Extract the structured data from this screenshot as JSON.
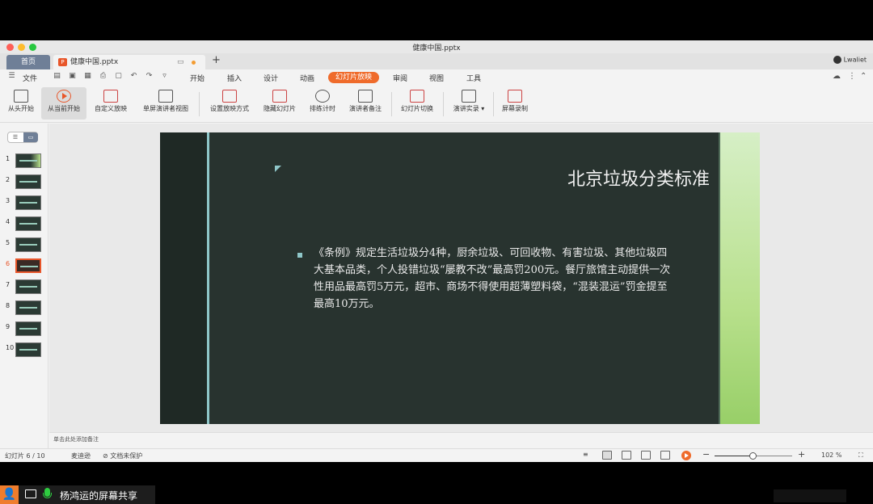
{
  "window": {
    "title": "健康中国.pptx",
    "tab_home": "首页",
    "tab_doc": "健康中国.pptx",
    "user": "Lwaliet"
  },
  "menu": {
    "file": "文件",
    "items": [
      "开始",
      "插入",
      "设计",
      "动画",
      "幻灯片放映",
      "审阅",
      "视图",
      "工具"
    ],
    "active": "幻灯片放映"
  },
  "ribbon": {
    "from_start": "从头开始",
    "from_current": "从当前开始",
    "custom_show": "自定义放映",
    "presenter_view": "单屏演讲者视图",
    "setup_show": "设置放映方式",
    "hide_slide": "隐藏幻灯片",
    "rehearse": "排练计时",
    "speaker_notes": "演讲者备注",
    "transition": "幻灯片切换",
    "record": "演讲实录",
    "screen_record": "屏幕录制"
  },
  "thumbnails": {
    "numbers": [
      "1",
      "2",
      "3",
      "4",
      "5",
      "6",
      "7",
      "8",
      "9",
      "10"
    ],
    "selected": "6"
  },
  "slide": {
    "title": "北京垃圾分类标准",
    "body": "《条例》规定生活垃圾分4种，厨余垃圾、可回收物、有害垃圾、其他垃圾四大基本品类，个人投错垃圾“屡教不改”最高罚200元。餐厅旅馆主动提供一次性用品最高罚5万元，超市、商场不得使用超薄塑料袋，“混装混运”罚金提至最高10万元。"
  },
  "notes_placeholder": "单击此处添加备注",
  "status": {
    "slide_count": "幻灯片 6 / 10",
    "theme": "麦迪逊",
    "protect": "文档未保护",
    "zoom": "102 %",
    "zoom_level": 0.5
  },
  "share": {
    "label": "杨鸿运的屏幕共享"
  },
  "colors": {
    "accent": "#ef6b2b",
    "slide_bg": "#28332f",
    "slide_accent": "#8fc7c9"
  }
}
